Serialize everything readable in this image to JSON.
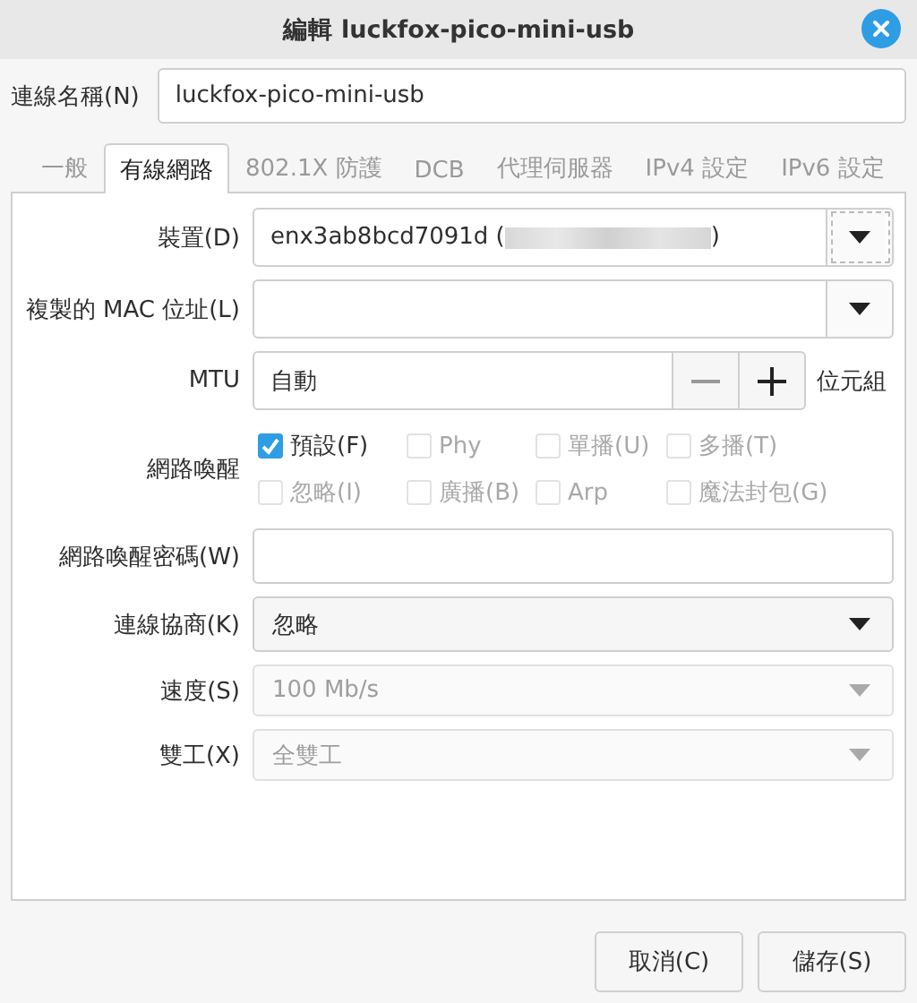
{
  "window": {
    "title": "編輯 luckfox-pico-mini-usb"
  },
  "connection_name": {
    "label": "連線名稱(N)",
    "value": "luckfox-pico-mini-usb"
  },
  "tabs": [
    {
      "label": "一般",
      "selected": false
    },
    {
      "label": "有線網路",
      "selected": true
    },
    {
      "label": "802.1X 防護",
      "selected": false
    },
    {
      "label": "DCB",
      "selected": false
    },
    {
      "label": "代理伺服器",
      "selected": false
    },
    {
      "label": "IPv4 設定",
      "selected": false
    },
    {
      "label": "IPv6 設定",
      "selected": false
    }
  ],
  "fields": [
    {
      "kind": "combo-entry",
      "label": "裝置(D)",
      "value_prefix": "enx3ab8bcd7091d (",
      "redacted": true,
      "value_suffix": ")"
    },
    {
      "kind": "combo-entry",
      "label": "複製的 MAC 位址(L)"
    },
    {
      "kind": "spin",
      "label": "MTU",
      "value": "自動",
      "unit": "位元組"
    },
    {
      "kind": "checks",
      "label": "網路喚醒",
      "options": [
        {
          "label": "預設(F)",
          "checked": true,
          "disabled": false
        },
        {
          "label": "Phy",
          "checked": false,
          "disabled": true
        },
        {
          "label": "單播(U)",
          "checked": false,
          "disabled": true
        },
        {
          "label": "多播(T)",
          "checked": false,
          "disabled": true
        },
        {
          "label": "忽略(I)",
          "checked": false,
          "disabled": true
        },
        {
          "label": "廣播(B)",
          "checked": false,
          "disabled": true
        },
        {
          "label": "Arp",
          "checked": false,
          "disabled": true
        },
        {
          "label": "魔法封包(G)",
          "checked": false,
          "disabled": true
        }
      ]
    },
    {
      "kind": "entry",
      "label": "網路喚醒密碼(W)"
    },
    {
      "kind": "combo",
      "label": "連線協商(K)",
      "value": "忽略",
      "disabled": false
    },
    {
      "kind": "combo",
      "label": "速度(S)",
      "value": "100 Mb/s",
      "disabled": true
    },
    {
      "kind": "combo",
      "label": "雙工(X)",
      "value": "全雙工",
      "disabled": true
    }
  ],
  "buttons": [
    {
      "label": "取消(C)"
    },
    {
      "label": "儲存(S)"
    }
  ]
}
